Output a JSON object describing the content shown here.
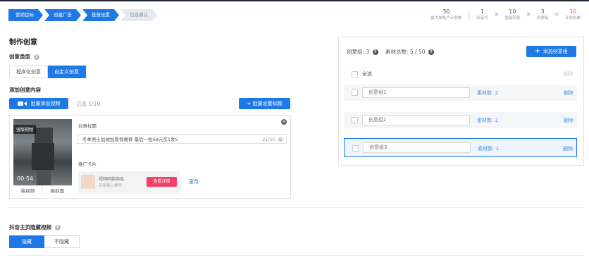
{
  "steps": [
    {
      "label": "营销目标",
      "state": "done"
    },
    {
      "label": "创建广告",
      "state": "done"
    },
    {
      "label": "投放设置",
      "state": "done"
    },
    {
      "label": "信息确认",
      "state": "todo"
    }
  ],
  "stats": {
    "max_plans": {
      "value": "30",
      "label": "最大单账户计划数"
    },
    "douyin": {
      "value": "1",
      "label": "抖音号"
    },
    "smart": {
      "value": "10",
      "label": "智能匹配"
    },
    "groups": {
      "value": "3",
      "label": "创意组"
    },
    "total": {
      "value": "30",
      "label": "计划总数"
    },
    "op_times": "×",
    "op_eq": "="
  },
  "page_title": "制作创意",
  "creative_type": {
    "label": "创意类型",
    "options": [
      "程序化创意",
      "自定义创意"
    ],
    "active_index": 1
  },
  "add_content": {
    "label": "添加创意内容",
    "batch_video_btn": "批量添加视频",
    "selected": "已选 1/10",
    "batch_title_btn": "+ 批量设置标题"
  },
  "creative_card": {
    "badge": "竖版视频",
    "duration": "00:54",
    "actions": [
      "换视频",
      "换封面"
    ],
    "title_label": "创意标题",
    "title_value": "冬季男士加绒加厚保暖裤 最后一批69元买1发5",
    "title_counter": "21/55",
    "promo_label": "推广卡片",
    "promo_title": "视频同款商品",
    "promo_sub": "商家精心推荐",
    "promo_button": "查看详情",
    "change_link": "更改"
  },
  "right_panel": {
    "group_count_label": "创意组: 3",
    "material_total_label": "素材总数: 5 / 50",
    "add_group_btn": "添加创意组",
    "select_all": "全选",
    "header_delete": "删除",
    "groups": [
      {
        "name": "创意组1",
        "materials": "素材数: 2",
        "delete": "删除",
        "highlighted": false
      },
      {
        "name": "创意组2",
        "materials": "素材数: 2",
        "delete": "删除",
        "highlighted": false
      },
      {
        "name": "创意组3",
        "materials": "素材数: 1",
        "delete": "删除",
        "highlighted": true
      }
    ]
  },
  "hidden_video": {
    "label": "抖音主页隐藏视频",
    "options": [
      "隐藏",
      "不隐藏"
    ],
    "active_index": 0
  },
  "colors": {
    "primary": "#1e78e6",
    "pink_button": "#f2406a",
    "link": "#4a90e2",
    "red_total": "#f25b5b"
  }
}
